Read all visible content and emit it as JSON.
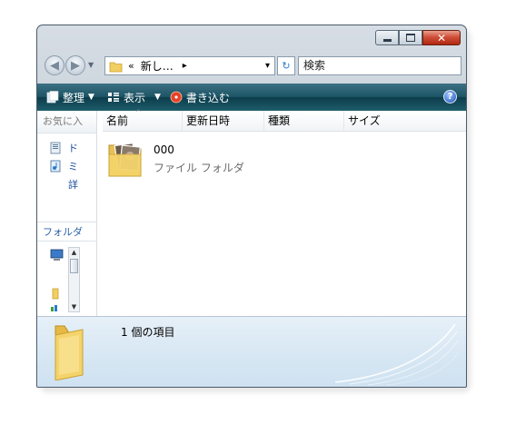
{
  "window": {
    "caption_buttons": {
      "minimize": "minimize",
      "maximize": "maximize",
      "close": "close"
    }
  },
  "address": {
    "chevrons": "«",
    "path": "新し…",
    "arrow": "▸",
    "dropdown": "▾",
    "search_placeholder": "検索"
  },
  "toolbar": {
    "organize": "整理",
    "views": "表示",
    "burn": "書き込む"
  },
  "navpane": {
    "header": "お気に入",
    "links": [
      "ド",
      "ミ",
      "詳"
    ],
    "folders_label": "フォルダ"
  },
  "columns": [
    "名前",
    "更新日時",
    "種類",
    "サイズ"
  ],
  "items": [
    {
      "name": "000",
      "type": "ファイル フォルダ"
    }
  ],
  "status": {
    "count_text": "1 個の項目"
  },
  "colors": {
    "toolbar": "#1d5566",
    "accent": "#1b4fa0",
    "close": "#d0503a"
  }
}
